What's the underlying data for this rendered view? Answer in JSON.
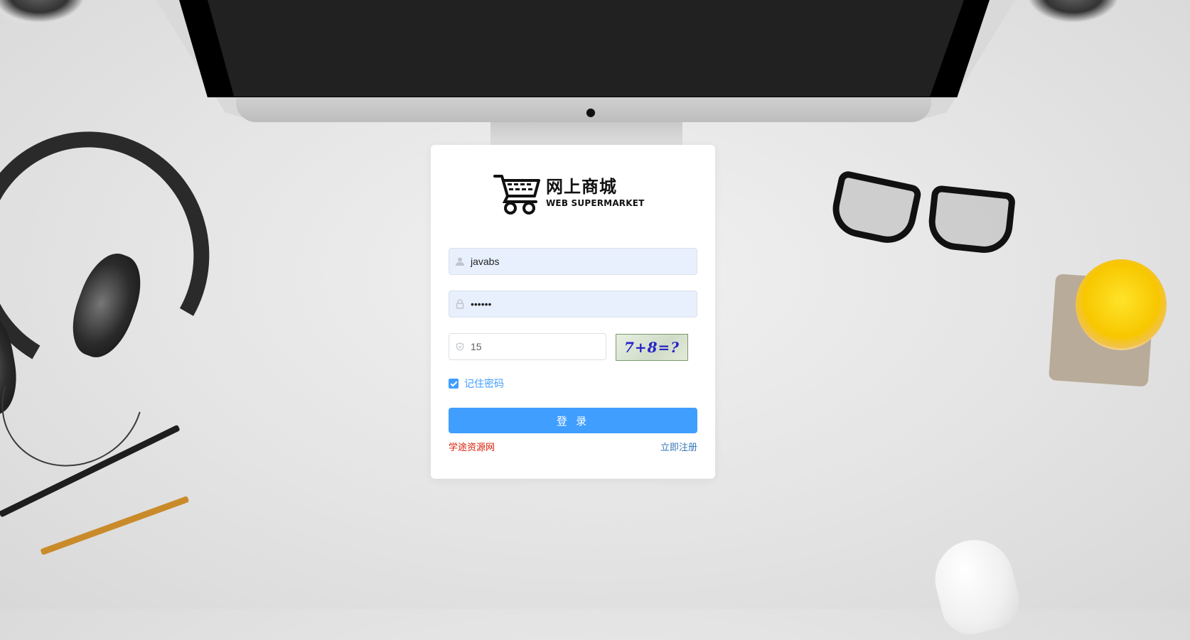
{
  "brand": {
    "name_cn": "网上商城",
    "name_en": "WEB SUPERMARKET"
  },
  "login_form": {
    "username": {
      "value": "javabs",
      "icon": "user-icon"
    },
    "password": {
      "value": "••••••",
      "icon": "lock-icon"
    },
    "captcha": {
      "value": "15",
      "icon": "shield-icon",
      "image_text": "7+8=?"
    },
    "remember": {
      "label": "记住密码",
      "checked": true
    },
    "submit_label": "登 录",
    "links": {
      "left": "学途资源网",
      "right": "立即注册"
    }
  },
  "colors": {
    "primary": "#409eff",
    "link_red": "#d81e06",
    "link_blue": "#3576b8",
    "autofill_bg": "#e8f0fe"
  }
}
